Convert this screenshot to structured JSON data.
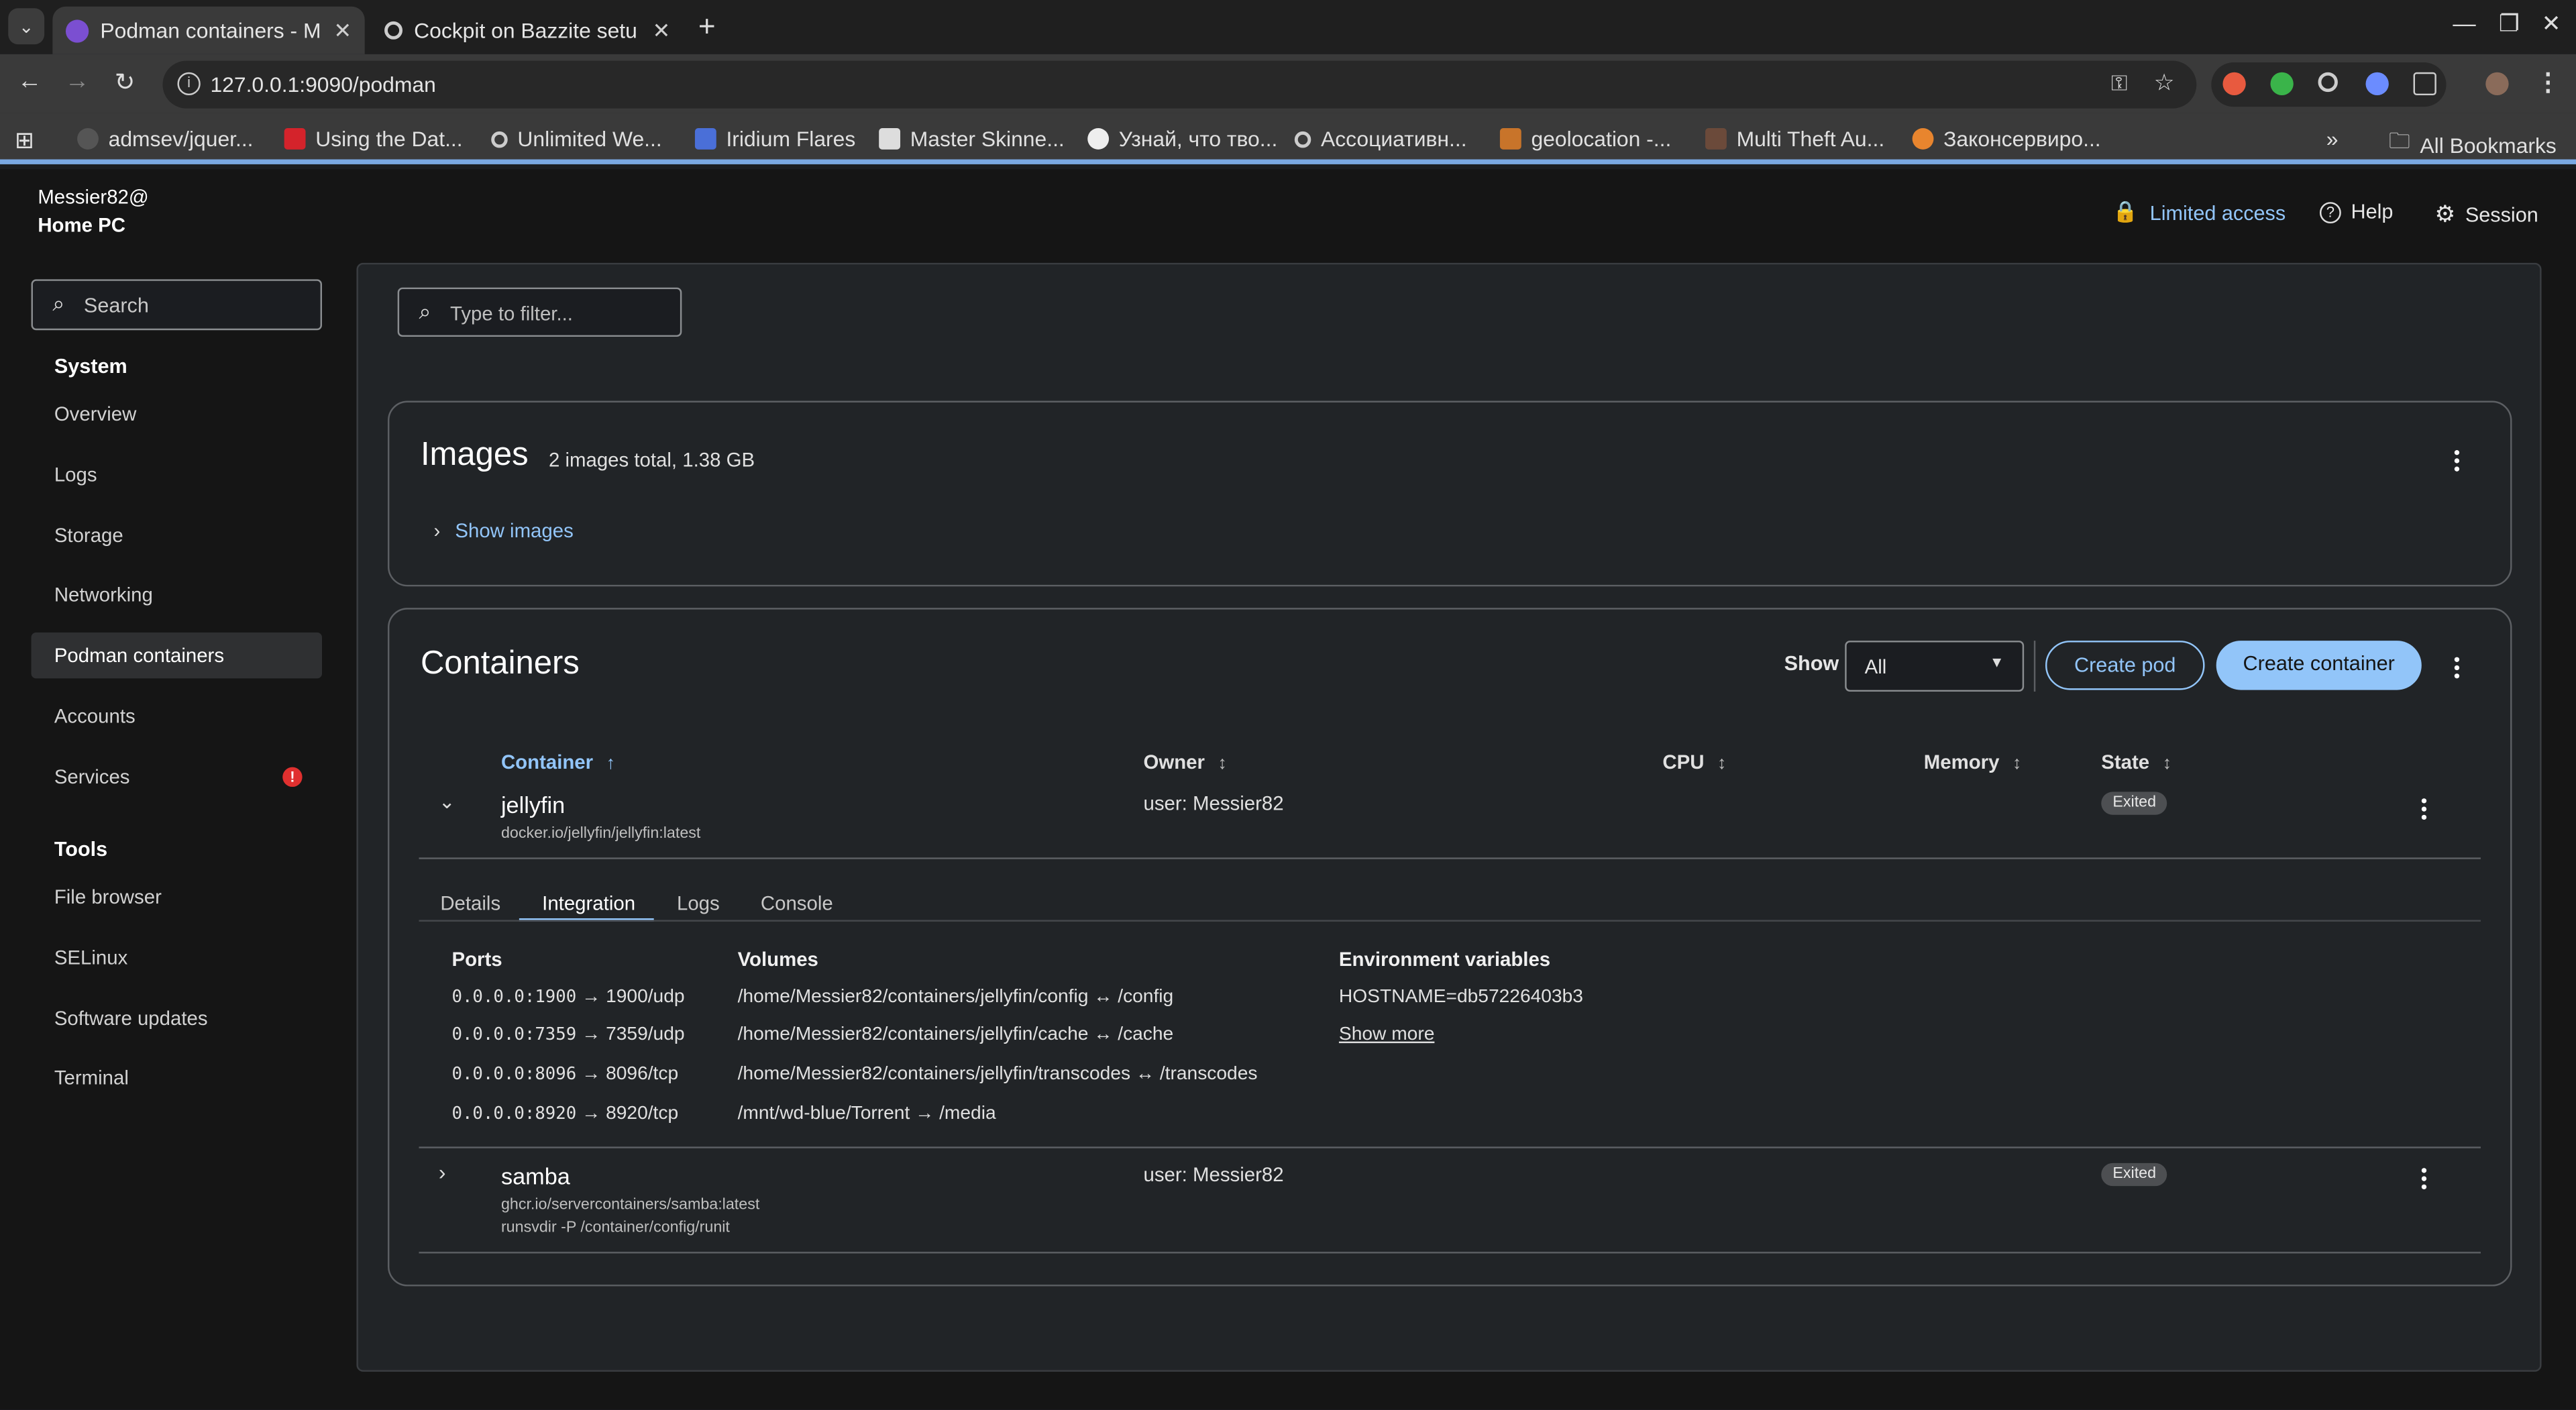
{
  "browser": {
    "tabs": [
      {
        "title": "Podman containers - M",
        "active": true
      },
      {
        "title": "Cockpit on Bazzite setu",
        "active": false
      }
    ],
    "url": "127.0.0.1:9090/podman",
    "bookmarks": [
      "admsev/jquer...",
      "Using the Dat...",
      "Unlimited We...",
      "Iridium Flares",
      "Master Skinne...",
      "Узнай, что тво...",
      "Ассоциативн...",
      "geolocation -...",
      "Multi Theft Au...",
      "Законсервиро..."
    ],
    "all_bookmarks": "All Bookmarks",
    "more": "»"
  },
  "host": {
    "user": "Messier82@",
    "machine": "Home PC"
  },
  "header": {
    "limited_access": "Limited access",
    "help": "Help",
    "session": "Session"
  },
  "sidebar": {
    "search_placeholder": "Search",
    "system_heading": "System",
    "system_items": [
      "Overview",
      "Logs",
      "Storage",
      "Networking",
      "Podman containers",
      "Accounts",
      "Services"
    ],
    "services_alert": "!",
    "tools_heading": "Tools",
    "tools_items": [
      "File browser",
      "SELinux",
      "Software updates",
      "Terminal"
    ]
  },
  "main": {
    "filter_placeholder": "Type to filter...",
    "images": {
      "title": "Images",
      "summary": "2 images total, 1.38 GB",
      "toggle": "Show images"
    },
    "containers": {
      "title": "Containers",
      "show_label": "Show",
      "show_value": "All",
      "create_pod": "Create pod",
      "create_container": "Create container",
      "columns": [
        "Container",
        "Owner",
        "CPU",
        "Memory",
        "State"
      ],
      "rows": [
        {
          "name": "jellyfin",
          "image": "docker.io/jellyfin/jellyfin:latest",
          "owner": "user: Messier82",
          "state": "Exited",
          "expanded": true
        },
        {
          "name": "samba",
          "image": "ghcr.io/servercontainers/samba:latest",
          "command": "runsvdir -P /container/config/runit",
          "owner": "user: Messier82",
          "state": "Exited",
          "expanded": false
        }
      ],
      "detail_tabs": [
        "Details",
        "Integration",
        "Logs",
        "Console"
      ],
      "active_tab": "Integration",
      "ports_heading": "Ports",
      "ports": [
        {
          "host": "0.0.0.0:1900",
          "container": "→ 1900/udp"
        },
        {
          "host": "0.0.0.0:7359",
          "container": "→ 7359/udp"
        },
        {
          "host": "0.0.0.0:8096",
          "container": "→ 8096/tcp"
        },
        {
          "host": "0.0.0.0:8920",
          "container": "→ 8920/tcp"
        }
      ],
      "volumes_heading": "Volumes",
      "volumes": [
        "/home/Messier82/containers/jellyfin/config ↔ /config",
        "/home/Messier82/containers/jellyfin/cache ↔ /cache",
        "/home/Messier82/containers/jellyfin/transcodes ↔ /transcodes",
        "/mnt/wd-blue/Torrent → /media"
      ],
      "env_heading": "Environment variables",
      "env": [
        "HOSTNAME=db57226403b3"
      ],
      "show_more": "Show more"
    }
  }
}
